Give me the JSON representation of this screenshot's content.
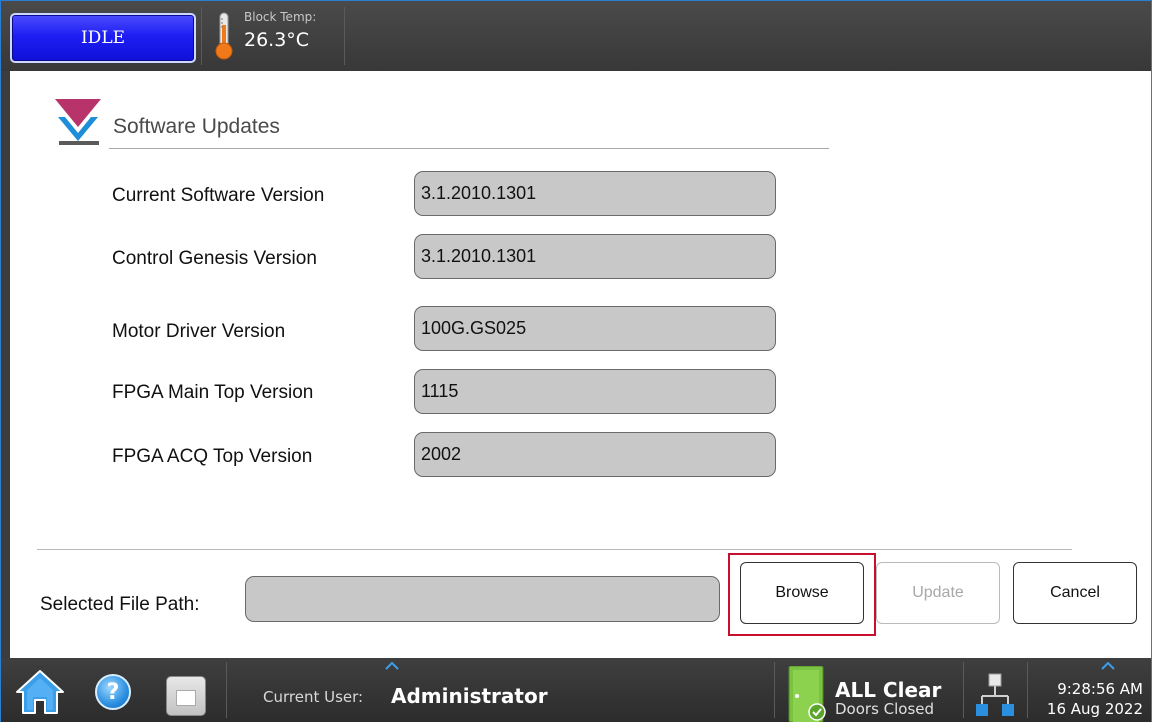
{
  "topbar": {
    "state_button": "IDLE",
    "block_temp_label": "Block Temp:",
    "block_temp_value": "26.3°C"
  },
  "page": {
    "title": "Software Updates",
    "versions": [
      {
        "label": "Current Software Version",
        "value": "3.1.2010.1301"
      },
      {
        "label": "Control Genesis Version",
        "value": "3.1.2010.1301"
      },
      {
        "label": "Motor Driver Version",
        "value": "100G.GS025"
      },
      {
        "label": "FPGA Main Top Version",
        "value": "1115"
      },
      {
        "label": "FPGA ACQ Top Version",
        "value": "2002"
      }
    ],
    "file_path_label": "Selected File Path:",
    "file_path_value": "",
    "buttons": {
      "browse": "Browse",
      "update": "Update",
      "cancel": "Cancel"
    }
  },
  "bottombar": {
    "icons": [
      "home-icon",
      "help-icon",
      "save-icon",
      "door-icon",
      "network-icon"
    ],
    "help_glyph": "?",
    "current_user_label": "Current User:",
    "current_user_value": "Administrator",
    "status_title": "ALL Clear",
    "status_sub": "Doors Closed",
    "time": "9:28:56 AM",
    "date": "16 Aug 2022"
  },
  "colors": {
    "accent_blue": "#1e1ef2",
    "highlight_red": "#c8102e",
    "field_gray": "#c8c8c8",
    "status_green": "#7cc242"
  }
}
